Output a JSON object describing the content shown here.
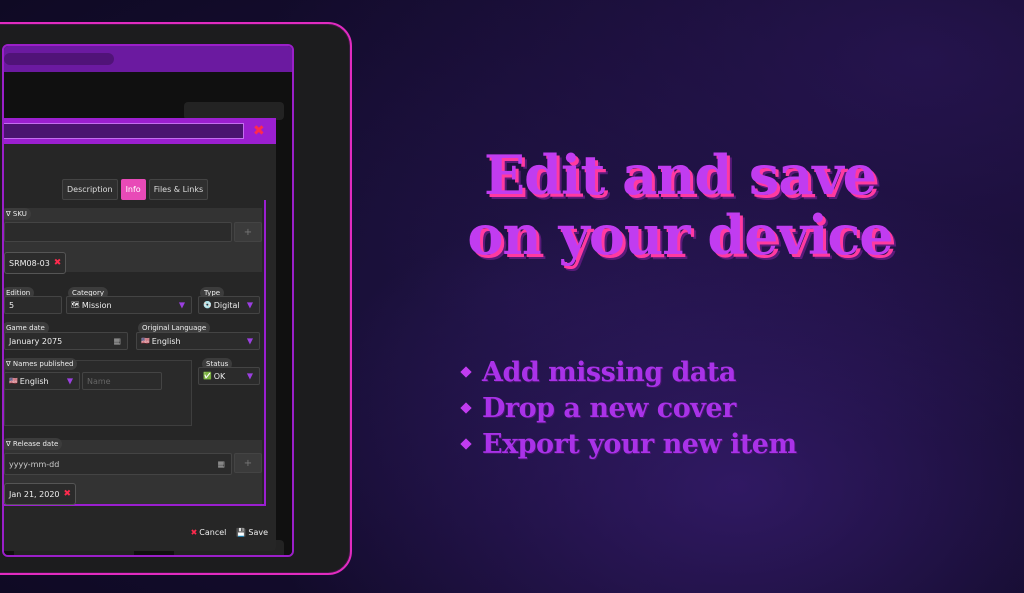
{
  "modal": {
    "tabs": [
      {
        "label": "Description"
      },
      {
        "label": "Info"
      },
      {
        "label": "Files & Links"
      }
    ],
    "sku": {
      "label": "∇ SKU",
      "chip": "SRM08-03"
    },
    "edition": {
      "label": "Edition",
      "value": "5"
    },
    "category": {
      "label": "Category",
      "value": "Mission",
      "icon": "🗺"
    },
    "type": {
      "label": "Type",
      "value": "Digital",
      "icon": "💿"
    },
    "game_date": {
      "label": "Game date",
      "value": "January 2075"
    },
    "original_language": {
      "label": "Original Language",
      "value": "English",
      "icon": "🇺🇸"
    },
    "names_published": {
      "label": "∇ Names published",
      "language": "English",
      "language_icon": "🇺🇸",
      "name_placeholder": "Name"
    },
    "status": {
      "label": "Status",
      "value": "OK",
      "icon": "✅"
    },
    "release_date": {
      "label": "∇ Release date",
      "placeholder": "yyyy-mm-dd",
      "chip": "Jan 21, 2020"
    },
    "footer": {
      "cancel": "Cancel",
      "save": "Save"
    }
  },
  "headline": {
    "line1": "Edit and save",
    "line2": "on your device"
  },
  "bullets": [
    "Add missing data",
    "Drop a new cover",
    "Export your new item"
  ],
  "colors": {
    "accent": "#c13cf0",
    "pink": "#e84ab7",
    "frame": "#e12bc0",
    "danger": "#ff2a4d"
  }
}
